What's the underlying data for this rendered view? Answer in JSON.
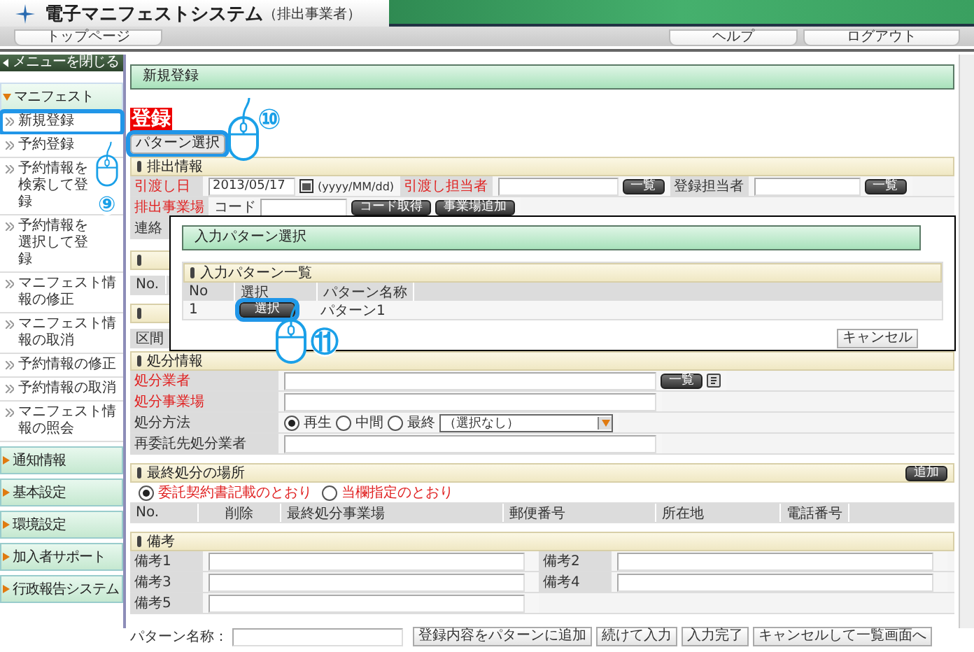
{
  "header": {
    "title": "電子マニフェストシステム",
    "subtitle": "（排出事業者）"
  },
  "top_tabs": [
    "トップページ"
  ],
  "right_tabs": [
    "ヘルプ",
    "ログアウト"
  ],
  "sidebar": {
    "close_label": "メニューを閉じる",
    "groups": [
      {
        "label": "マニフェスト",
        "expanded": true,
        "children": [
          {
            "label": "新規登録",
            "highlighted": true
          },
          {
            "label": "予約登録",
            "highlighted": false
          },
          {
            "label": "予約情報を検索して登録",
            "highlighted": false
          },
          {
            "label": "予約情報を選択して登録",
            "highlighted": false
          },
          {
            "label": "マニフェスト情報の修正",
            "highlighted": false
          },
          {
            "label": "マニフェスト情報の取消",
            "highlighted": false
          },
          {
            "label": "予約情報の修正",
            "highlighted": false
          },
          {
            "label": "予約情報の取消",
            "highlighted": false
          },
          {
            "label": "マニフェスト情報の照会",
            "highlighted": false
          }
        ]
      },
      {
        "label": "通知情報",
        "expanded": false
      },
      {
        "label": "基本設定",
        "expanded": false
      },
      {
        "label": "環境設定",
        "expanded": false
      },
      {
        "label": "加入者サポート",
        "expanded": false
      },
      {
        "label": "行政報告システム",
        "expanded": false
      }
    ]
  },
  "page_title": "新規登録",
  "badge": "登録",
  "pattern_button": {
    "label": "パターン選択",
    "highlighted": true
  },
  "emission": {
    "title": "排出情報",
    "date_label": {
      "text": "引渡し日",
      "required": true
    },
    "date_value": "2013/05/17",
    "date_format": "(yyyy/MM/dd)",
    "handler_label": {
      "text": "引渡し担当者",
      "required": true
    },
    "registrant_label": {
      "text": "登録担当者",
      "required": false
    },
    "list_buttons": [
      "一覧",
      "一覧"
    ],
    "site_label": {
      "text": "排出事業場",
      "required": true
    },
    "code_label": "コード",
    "code_buttons": [
      "コード取得",
      "事業場追加"
    ],
    "contact_label": "連絡"
  },
  "covered": {
    "column_no": "No.",
    "column_section": "区間"
  },
  "disposal": {
    "title": "処分情報",
    "rows": [
      {
        "kind": "lookup",
        "label": "処分業者",
        "required": true,
        "button": "一覧"
      },
      {
        "kind": "text",
        "label": "処分事業場",
        "required": true
      },
      {
        "kind": "method",
        "label": "処分方法",
        "required": false,
        "options": [
          {
            "label": "再生",
            "selected": true
          },
          {
            "label": "中間",
            "selected": false
          },
          {
            "label": "最終",
            "selected": false
          }
        ],
        "select": "（選択なし）"
      },
      {
        "kind": "text",
        "label": "再委託先処分業者",
        "required": false
      }
    ]
  },
  "final": {
    "title": "最終処分の場所",
    "add_button": "追加",
    "options": [
      {
        "label": "委託契約書記載のとおり",
        "selected": true
      },
      {
        "label": "当欄指定のとおり",
        "selected": false
      }
    ],
    "columns": [
      "No.",
      "削除",
      "最終処分事業場",
      "郵便番号",
      "所在地",
      "電話番号"
    ]
  },
  "notes": {
    "title": "備考",
    "rows": [
      [
        "備考1",
        "備考2"
      ],
      [
        "備考3",
        "備考4"
      ],
      [
        "備考5"
      ]
    ]
  },
  "footer": {
    "pattern_name_label": "パターン名称：",
    "buttons": [
      "登録内容をパターンに追加",
      "続けて入力",
      "入力完了",
      "キャンセルして一覧画面へ"
    ]
  },
  "popup": {
    "title": "入力パターン選択",
    "list_title": "入力パターン一覧",
    "columns": [
      "No",
      "選択",
      "パターン名称"
    ],
    "rows": [
      {
        "no": "1",
        "button": "選択",
        "name": "パターン1",
        "highlighted": true
      }
    ],
    "cancel": "キャンセル"
  },
  "annotations": [
    {
      "number": "⑨"
    },
    {
      "number": "⑩"
    },
    {
      "number": "⑪"
    }
  ]
}
